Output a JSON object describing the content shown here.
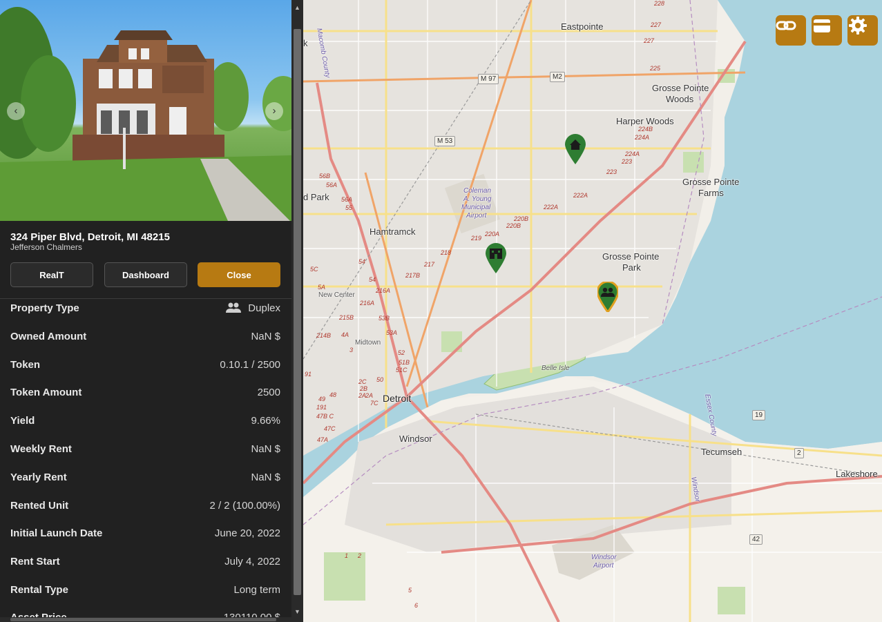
{
  "property": {
    "address": "324 Piper Blvd, Detroit, MI 48215",
    "neighborhood": "Jefferson Chalmers"
  },
  "actions": {
    "realt_label": "RealT",
    "dashboard_label": "Dashboard",
    "close_label": "Close"
  },
  "details": [
    {
      "label": "Property Type",
      "value": "Duplex",
      "icon": "people-icon"
    },
    {
      "label": "Owned Amount",
      "value": "NaN $"
    },
    {
      "label": "Token",
      "value": "0.10.1 / 2500"
    },
    {
      "label": "Token Amount",
      "value": "2500"
    },
    {
      "label": "Yield",
      "value": "9.66%"
    },
    {
      "label": "Weekly Rent",
      "value": "NaN $"
    },
    {
      "label": "Yearly Rent",
      "value": "NaN $"
    },
    {
      "label": "Rented Unit",
      "value": "2 / 2 (100.00%)"
    },
    {
      "label": "Initial Launch Date",
      "value": "June 20, 2022"
    },
    {
      "label": "Rent Start",
      "value": "July 4, 2022"
    },
    {
      "label": "Rental Type",
      "value": "Long term"
    },
    {
      "label": "Asset Price",
      "value": "130110.00 $"
    }
  ],
  "map": {
    "places": {
      "eastpointe": "Eastpointe",
      "grosse_pointe_woods_1": "Grosse Pointe",
      "grosse_pointe_woods_2": "Woods",
      "harper_woods": "Harper Woods",
      "grosse_pointe_farms_1": "Grosse Pointe",
      "grosse_pointe_farms_2": "Farms",
      "grosse_pointe_park_1": "Grosse Pointe",
      "grosse_pointe_park_2": "Park",
      "hamtramck": "Hamtramck",
      "new_center": "New Center",
      "midtown": "Midtown",
      "detroit": "Detroit",
      "windsor": "Windsor",
      "tecumseh": "Tecumseh",
      "lakeshore": "Lakeshore",
      "belle_isle": "Belle Isle",
      "coleman_1": "Coleman",
      "coleman_2": "A. Young",
      "coleman_3": "Municipal",
      "coleman_4": "Airport",
      "windsor_airport_1": "Windsor",
      "windsor_airport_2": "Airport",
      "macomb": "Macomb County",
      "essex": "Essex County",
      "windsor_road": "Windsor",
      "park_fragment": "d Park",
      "k_fragment": "k"
    },
    "shields": {
      "m97": "M 97",
      "m53": "M 53",
      "m102": "M2",
      "r19": "19",
      "r2": "2",
      "r42": "42"
    },
    "exits": [
      "228",
      "227",
      "227",
      "225",
      "224B",
      "224A",
      "224A",
      "223",
      "223",
      "222A",
      "222A",
      "220B",
      "220B",
      "220A",
      "219",
      "218",
      "217",
      "217B",
      "216A",
      "216A",
      "215B",
      "214B",
      "56B",
      "56A",
      "55",
      "56A",
      "54",
      "54",
      "5C",
      "5A",
      "53B",
      "53A",
      "52",
      "51B",
      "51C",
      "50",
      "2C",
      "2B",
      "2A",
      "2A",
      "7C",
      "48",
      "49",
      "191",
      "47B C",
      "47C",
      "47A",
      "4A",
      "3",
      "91",
      "1",
      "2",
      "5",
      "6"
    ],
    "markers": [
      {
        "kind": "home",
        "color": "#2e7d32"
      },
      {
        "kind": "building",
        "color": "#2e7d32"
      },
      {
        "kind": "people",
        "color": "#2e7d32",
        "ring": "#e0a020"
      }
    ]
  },
  "colors": {
    "accent": "#b77a12",
    "sidebar_bg": "#212121",
    "water": "#aad3df",
    "marker_green": "#2e7d32"
  }
}
